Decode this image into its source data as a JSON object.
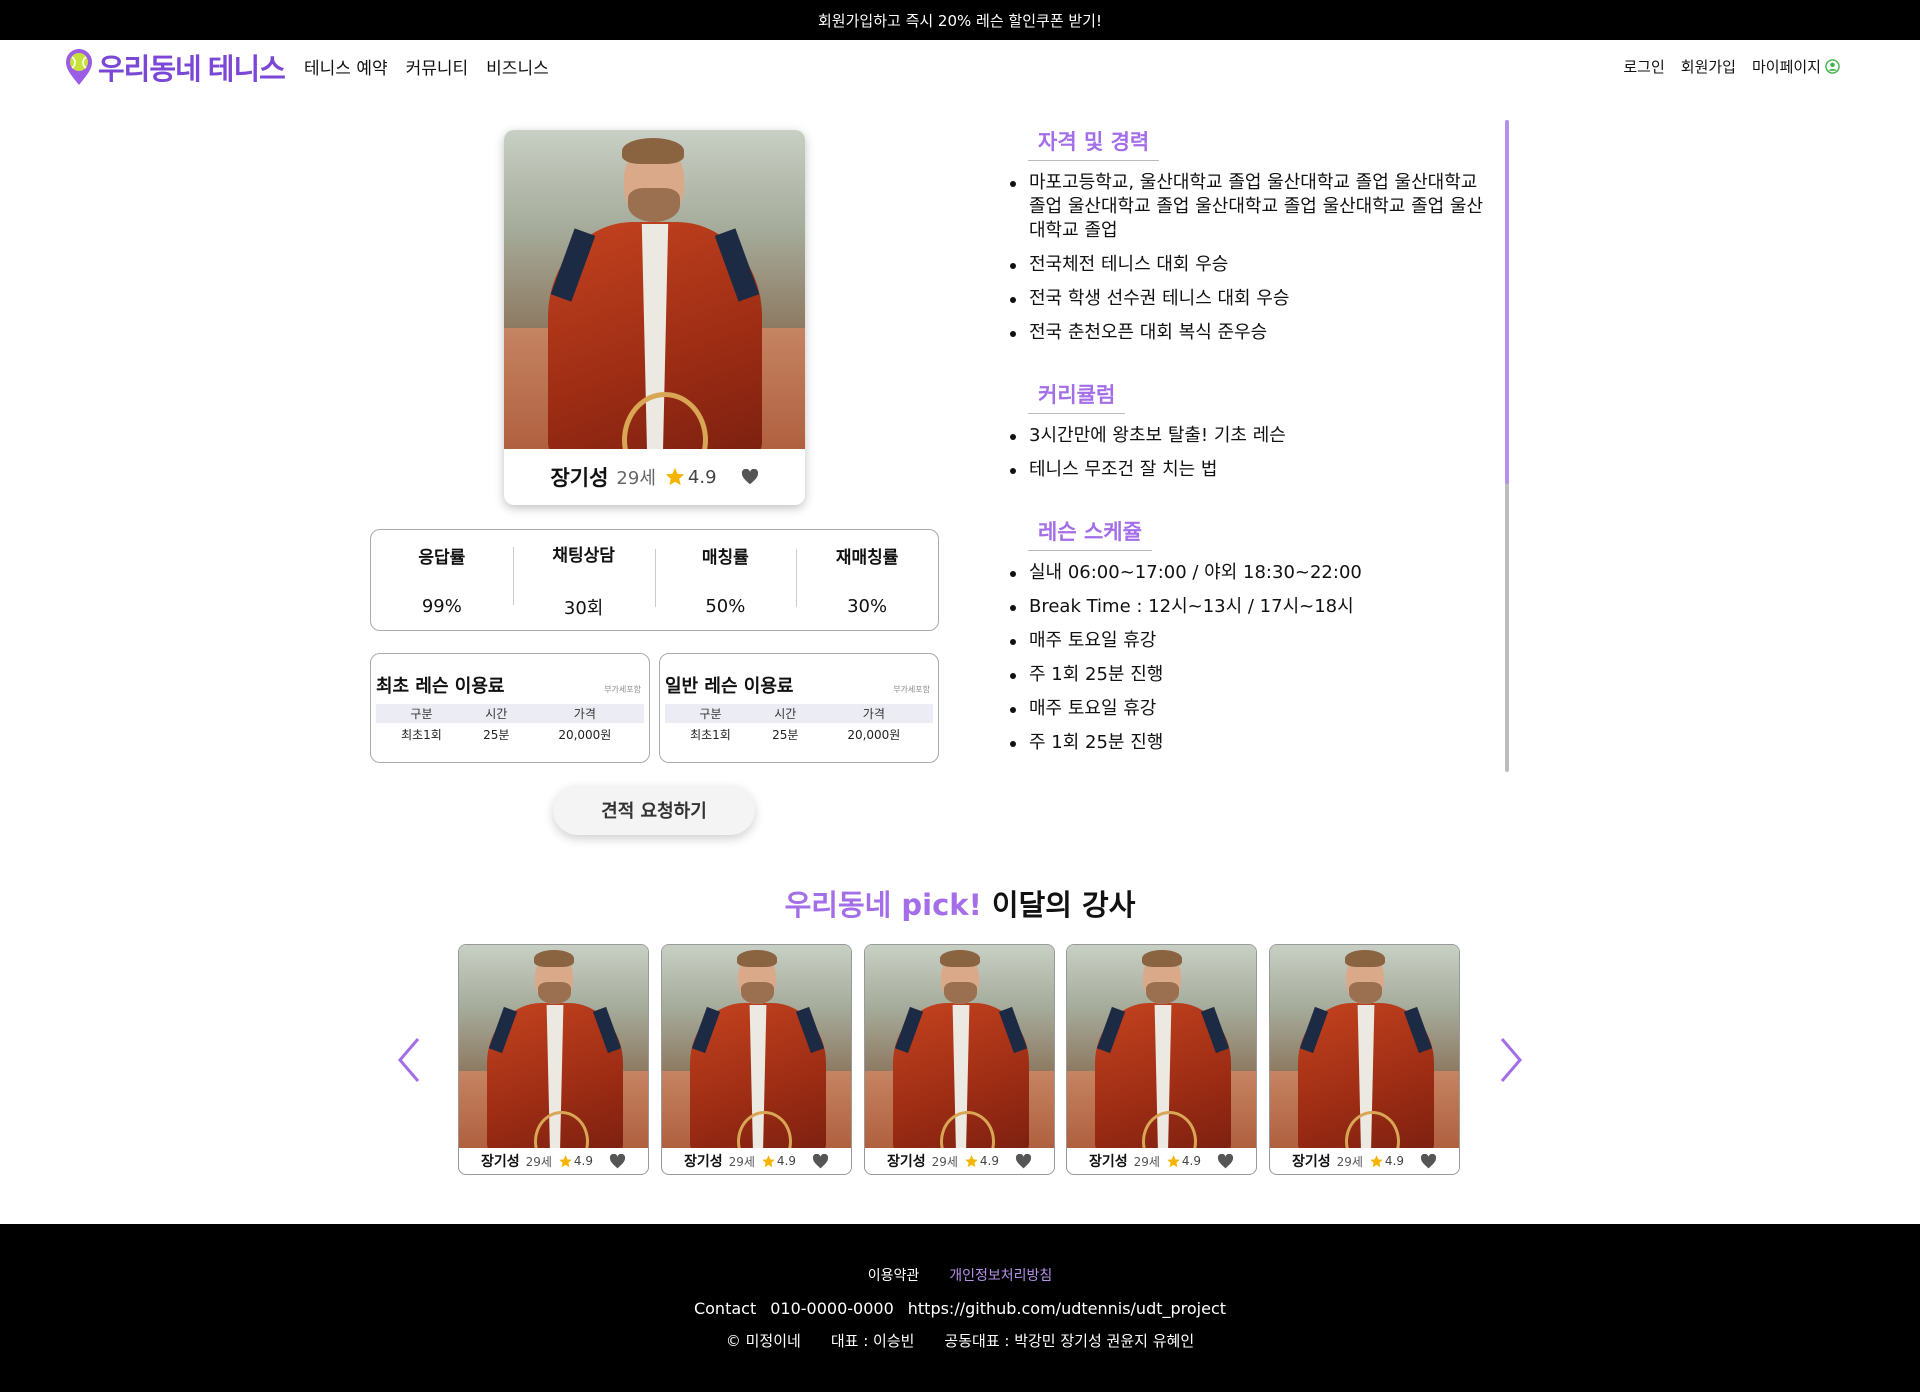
{
  "promo_banner": "회원가입하고 즉시 20% 레슨 할인쿠폰 받기!",
  "header": {
    "logo_text": "우리동네 테니스",
    "nav": [
      "테니스 예약",
      "커뮤니티",
      "비즈니스"
    ],
    "login": "로그인",
    "signup": "회원가입",
    "mypage": "마이페이지"
  },
  "colors": {
    "accent": "#a36ee8",
    "logo": "#7a47d6",
    "star": "#f5b400",
    "user_icon": "#3fb24a"
  },
  "instructor": {
    "name": "장기성",
    "age": "29세",
    "rating": "4.9"
  },
  "stats": [
    {
      "label": "응답률",
      "value": "99%"
    },
    {
      "label": "채팅상담",
      "value": "30회"
    },
    {
      "label": "매칭률",
      "value": "50%"
    },
    {
      "label": "재매칭률",
      "value": "30%"
    }
  ],
  "price_boxes": [
    {
      "title": "최초 레슨 이용료",
      "vat": "부가세포함",
      "headers": [
        "구분",
        "시간",
        "가격"
      ],
      "row": [
        "최초1회",
        "25분",
        "20,000원"
      ]
    },
    {
      "title": "일반 레슨 이용료",
      "vat": "부가세포함",
      "headers": [
        "구분",
        "시간",
        "가격"
      ],
      "row": [
        "최초1회",
        "25분",
        "20,000원"
      ]
    }
  ],
  "quote_button": "견적 요청하기",
  "sections": [
    {
      "title": "자격 및 경력",
      "items": [
        "마포고등학교, 울산대학교 졸업 울산대학교 졸업 울산대학교 졸업 울산대학교 졸업 울산대학교 졸업 울산대학교 졸업 울산대학교 졸업",
        "전국체전 테니스 대회 우승",
        "전국 학생 선수권 테니스 대회 우승",
        "전국 춘천오픈 대회 복식 준우승"
      ]
    },
    {
      "title": "커리큘럼",
      "items": [
        "3시간만에 왕초보 탈출! 기초 레슨",
        "테니스 무조건 잘 치는 법"
      ]
    },
    {
      "title": "레슨 스케쥴",
      "items": [
        "실내 06:00~17:00 / 야외 18:30~22:00",
        "Break Time : 12시~13시 / 17시~18시",
        "매주 토요일 휴강",
        "주 1회 25분 진행",
        "매주 토요일 휴강",
        "주 1회 25분 진행"
      ]
    }
  ],
  "pick": {
    "title_accent": "우리동네 pick!",
    "title_rest": " 이달의 강사",
    "cards": [
      {
        "name": "장기성",
        "age": "29세",
        "rating": "4.9"
      },
      {
        "name": "장기성",
        "age": "29세",
        "rating": "4.9"
      },
      {
        "name": "장기성",
        "age": "29세",
        "rating": "4.9"
      },
      {
        "name": "장기성",
        "age": "29세",
        "rating": "4.9"
      },
      {
        "name": "장기성",
        "age": "29세",
        "rating": "4.9"
      }
    ]
  },
  "footer": {
    "terms": "이용약관",
    "privacy": "개인정보처리방침",
    "contact_label": "Contact",
    "phone": "010-0000-0000",
    "github": "https://github.com/udtennis/udt_project",
    "copyright": "© 미정이네",
    "ceo": "대표 : 이승빈",
    "co_ceo": "공동대표 : 박강민 장기성 권윤지 유혜인"
  }
}
